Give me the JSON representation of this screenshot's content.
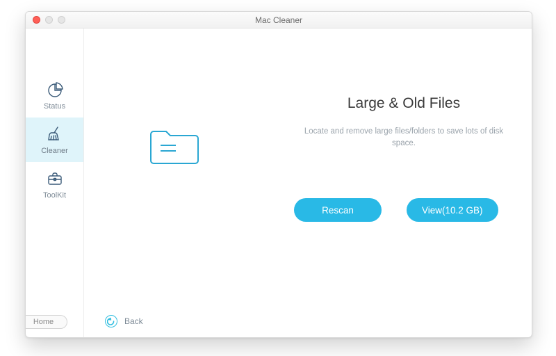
{
  "window": {
    "title": "Mac Cleaner"
  },
  "sidebar": {
    "items": [
      {
        "label": "Status"
      },
      {
        "label": "Cleaner"
      },
      {
        "label": "ToolKit"
      }
    ],
    "home": "Home"
  },
  "back": {
    "label": "Back"
  },
  "main": {
    "heading": "Large & Old Files",
    "description": "Locate and remove large files/folders to save lots of disk space."
  },
  "buttons": {
    "rescan": "Rescan",
    "view": "View(10.2 GB)"
  }
}
